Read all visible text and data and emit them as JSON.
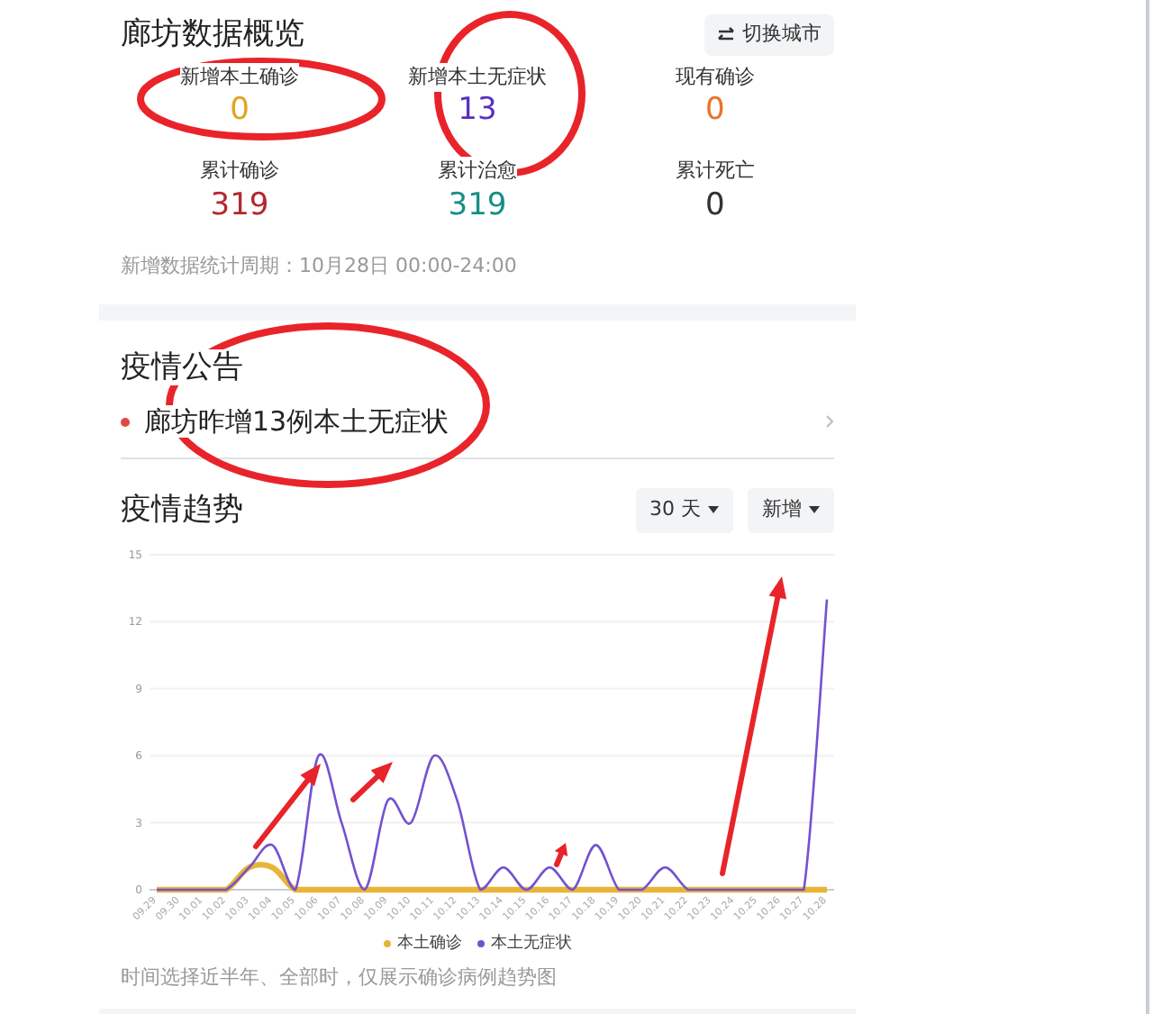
{
  "overview": {
    "title": "廊坊数据概览",
    "switch_button": "切换城市",
    "stats": [
      {
        "label": "新增本土确诊",
        "value": "0",
        "color": "#e0a525"
      },
      {
        "label": "新增本土无症状",
        "value": "13",
        "color": "#5b2fc0"
      },
      {
        "label": "现有确诊",
        "value": "0",
        "color": "#e8742c"
      },
      {
        "label": "累计确诊",
        "value": "319",
        "color": "#b3282d"
      },
      {
        "label": "累计治愈",
        "value": "319",
        "color": "#178f86"
      },
      {
        "label": "累计死亡",
        "value": "0",
        "color": "#333333"
      }
    ],
    "note": "新增数据统计周期：10月28日 00:00-24:00"
  },
  "announcements": {
    "title": "疫情公告",
    "items": [
      {
        "text": "廊坊昨增13例本土无症状"
      }
    ]
  },
  "trend": {
    "title": "疫情趋势",
    "filters": [
      "30 天",
      "新增"
    ],
    "chart_data": {
      "type": "line",
      "categories": [
        "09.29",
        "09.30",
        "10.01",
        "10.02",
        "10.03",
        "10.04",
        "10.05",
        "10.06",
        "10.07",
        "10.08",
        "10.09",
        "10.10",
        "10.11",
        "10.12",
        "10.13",
        "10.14",
        "10.15",
        "10.16",
        "10.17",
        "10.18",
        "10.19",
        "10.20",
        "10.21",
        "10.22",
        "10.23",
        "10.24",
        "10.25",
        "10.26",
        "10.27",
        "10.28"
      ],
      "series": [
        {
          "name": "本土确诊",
          "color": "#e8b53a",
          "values": [
            0,
            0,
            0,
            0,
            1,
            1,
            0,
            0,
            0,
            0,
            0,
            0,
            0,
            0,
            0,
            0,
            0,
            0,
            0,
            0,
            0,
            0,
            0,
            0,
            0,
            0,
            0,
            0,
            0,
            0
          ]
        },
        {
          "name": "本土无症状",
          "color": "#7452cf",
          "values": [
            0,
            0,
            0,
            0,
            1,
            2,
            0,
            6,
            3,
            0,
            4,
            3,
            6,
            4,
            0,
            1,
            0,
            1,
            0,
            2,
            0,
            0,
            1,
            0,
            0,
            0,
            0,
            0,
            0,
            13
          ]
        }
      ],
      "grid": true,
      "ylim": [
        0,
        15
      ],
      "yticks": [
        0,
        3,
        6,
        9,
        12,
        15
      ]
    },
    "note": "时间选择近半年、全部时，仅展示确诊病例趋势图"
  }
}
